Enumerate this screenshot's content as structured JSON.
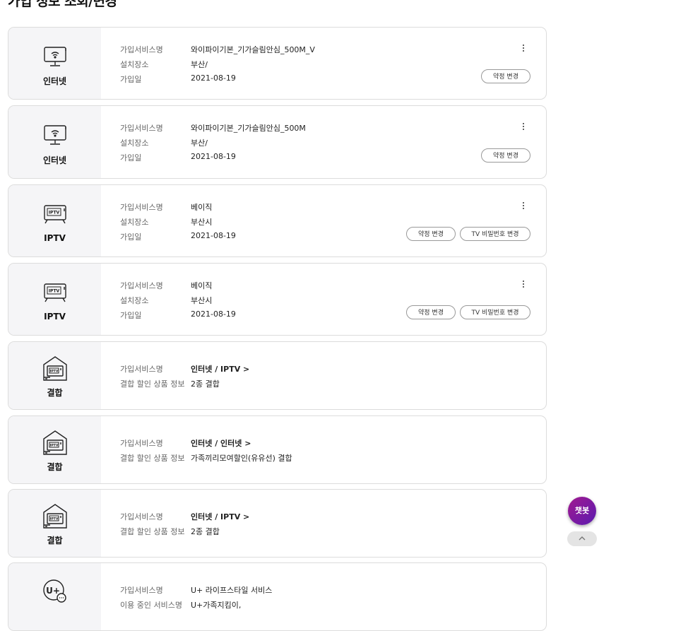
{
  "page": {
    "title": "가입 정보 조회/변경"
  },
  "labels": {
    "service_name": "가입서비스명",
    "location": "설치장소",
    "join_date": "가입일",
    "bundle_info": "결합 할인 상품 정보",
    "using_service": "이용 중인 서비스명"
  },
  "cards": [
    {
      "type": "인터넷",
      "icon": "monitor-wifi-icon",
      "service": "와이파이기본_기가슬림안심_500M_V",
      "location": "부산/",
      "date": "2021-08-19",
      "btn1": "약정 변경"
    },
    {
      "type": "인터넷",
      "icon": "monitor-wifi-icon",
      "service": "와이파이기본_기가슬림안심_500M",
      "location": "부산/",
      "date": "2021-08-19",
      "btn1": "약정 변경"
    },
    {
      "type": "IPTV",
      "icon": "tv-iptv-icon",
      "service": "베이직",
      "location": "부산시",
      "date": "2021-08-19",
      "btn1": "약정 변경",
      "btn2": "TV 비밀번호 변경"
    },
    {
      "type": "IPTV",
      "icon": "tv-iptv-icon",
      "service": "베이직",
      "location": "부산시",
      "date": "2021-08-19",
      "btn1": "약정 변경",
      "btn2": "TV 비밀번호 변경"
    },
    {
      "type": "결합",
      "icon": "home-iptv-icon",
      "service": "인터넷 / IPTV >",
      "bundle": "2종 결합"
    },
    {
      "type": "결합",
      "icon": "home-iptv-icon",
      "service": "인터넷 / 인터넷 >",
      "bundle": "가족끼리모여할인(유유선) 결합"
    },
    {
      "type": "결합",
      "icon": "home-iptv-icon",
      "service": "인터넷 / IPTV >",
      "bundle": "2종 결합"
    },
    {
      "type": "",
      "icon": "uplus-icon",
      "service": "U+ 라이프스타일 서비스",
      "using": "U+가족지킴이,"
    }
  ],
  "floating": {
    "chatbot": "챗봇",
    "top_icon": "chevron-up-icon"
  },
  "colors": {
    "chatbot_start": "#a21a8f",
    "chatbot_end": "#5b1bb0",
    "side_bg": "#f5f5f7"
  }
}
